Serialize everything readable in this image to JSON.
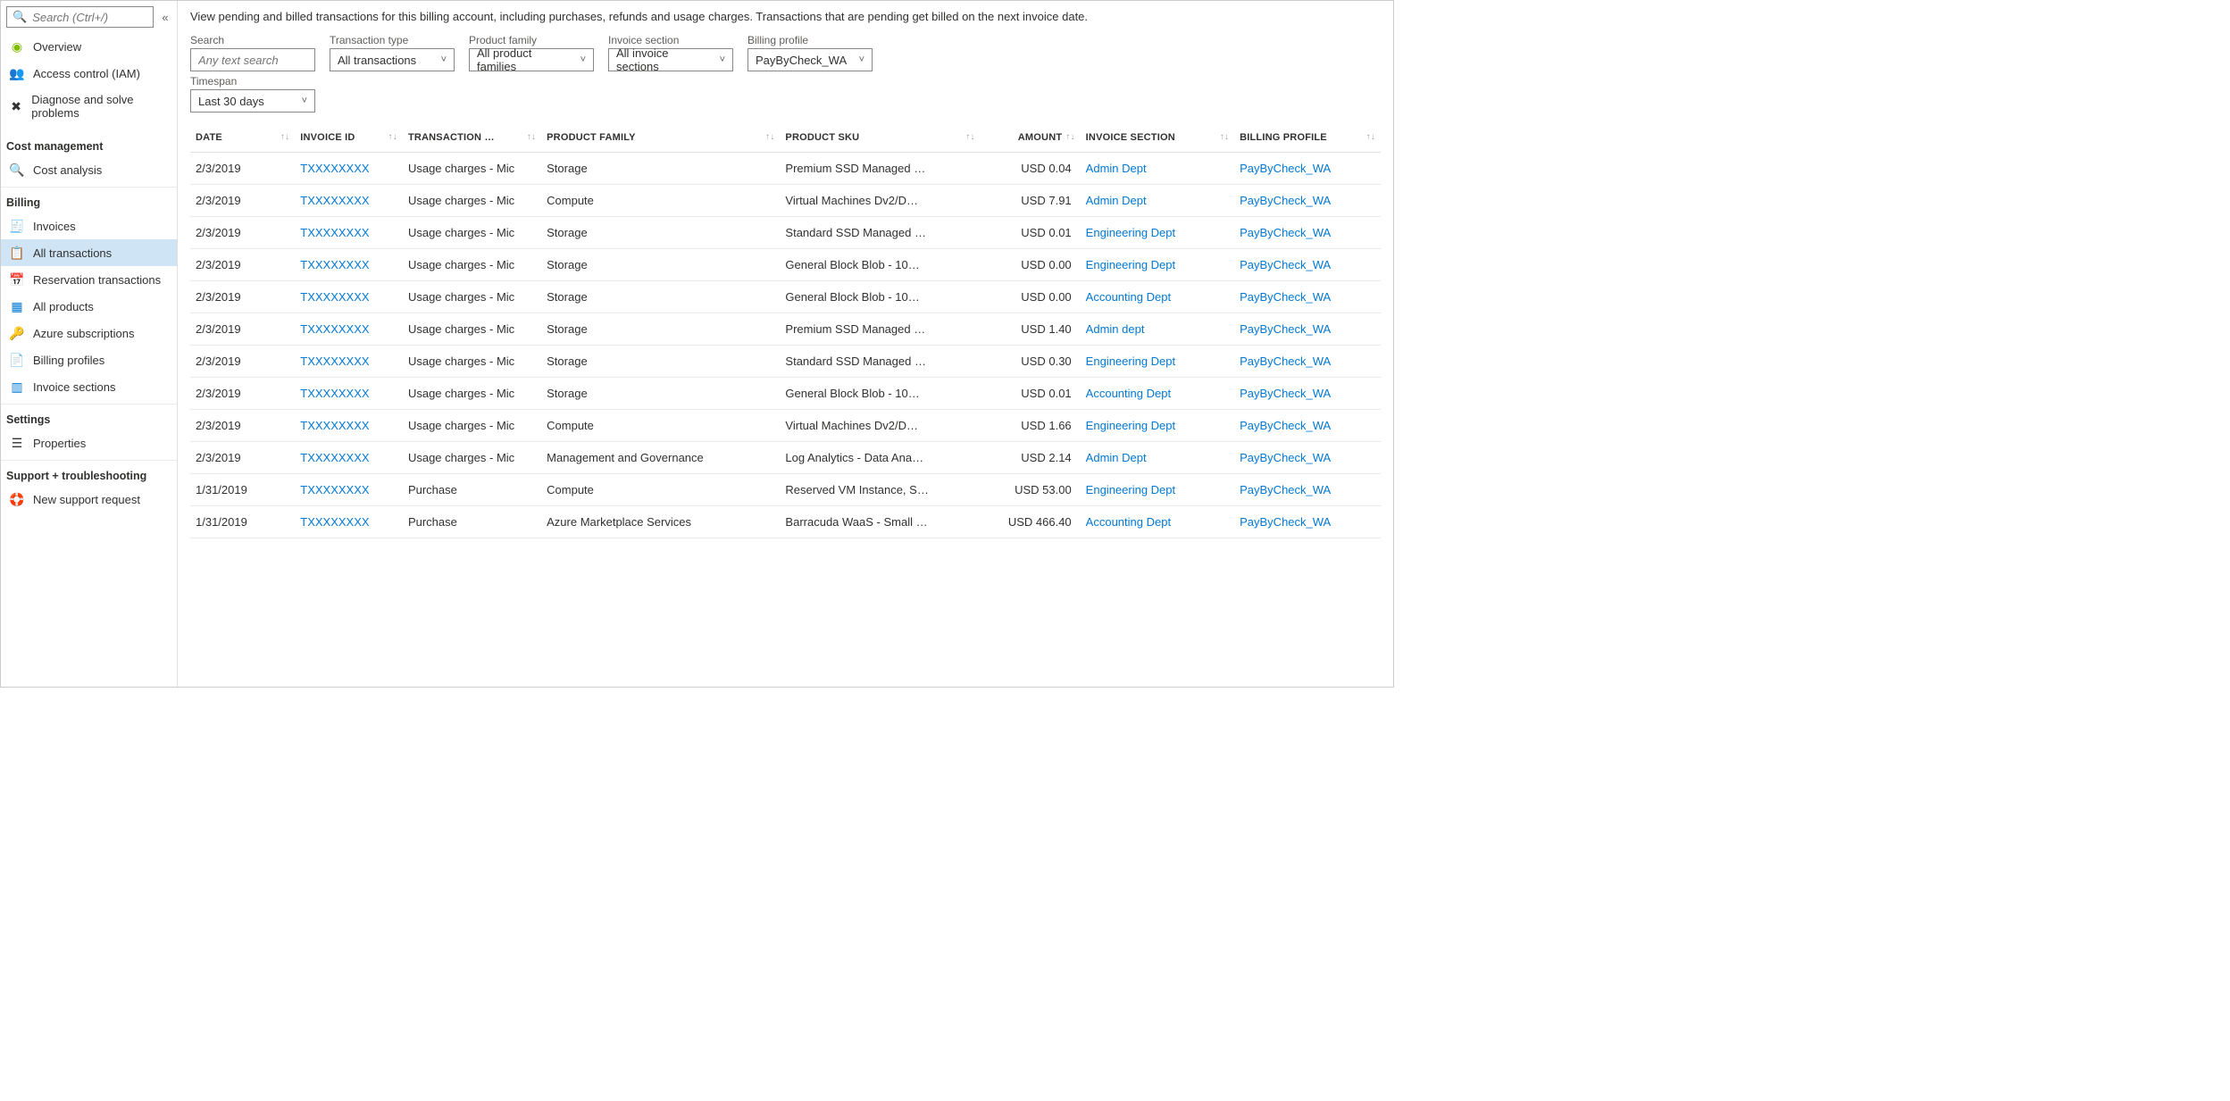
{
  "sidebar": {
    "search_placeholder": "Search (Ctrl+/)",
    "collapse": "«",
    "top_items": [
      {
        "icon": "overview",
        "label": "Overview"
      },
      {
        "icon": "iam",
        "label": "Access control (IAM)"
      },
      {
        "icon": "diagnose",
        "label": "Diagnose and solve problems"
      }
    ],
    "sections": [
      {
        "title": "Cost management",
        "items": [
          {
            "icon": "cost",
            "label": "Cost analysis"
          }
        ]
      },
      {
        "title": "Billing",
        "items": [
          {
            "icon": "invoices",
            "label": "Invoices"
          },
          {
            "icon": "alltx",
            "label": "All transactions",
            "active": true
          },
          {
            "icon": "resv",
            "label": "Reservation transactions"
          },
          {
            "icon": "products",
            "label": "All products"
          },
          {
            "icon": "azsub",
            "label": "Azure subscriptions"
          },
          {
            "icon": "bprof",
            "label": "Billing profiles"
          },
          {
            "icon": "invsec",
            "label": "Invoice sections"
          }
        ]
      },
      {
        "title": "Settings",
        "items": [
          {
            "icon": "props",
            "label": "Properties"
          }
        ]
      },
      {
        "title": "Support + troubleshooting",
        "items": [
          {
            "icon": "support",
            "label": "New support request"
          }
        ]
      }
    ]
  },
  "main": {
    "intro": "View pending and billed transactions for this billing account, including purchases, refunds and usage charges. Transactions that are pending get billed on the next invoice date.",
    "filters": {
      "search": {
        "label": "Search",
        "placeholder": "Any text search"
      },
      "transaction_type": {
        "label": "Transaction type",
        "value": "All transactions"
      },
      "product_family": {
        "label": "Product family",
        "value": "All product families"
      },
      "invoice_section": {
        "label": "Invoice section",
        "value": "All invoice sections"
      },
      "billing_profile": {
        "label": "Billing profile",
        "value": "PayByCheck_WA"
      },
      "timespan": {
        "label": "Timespan",
        "value": "Last 30 days"
      }
    },
    "columns": [
      "DATE",
      "INVOICE ID",
      "TRANSACTION …",
      "PRODUCT FAMILY",
      "PRODUCT SKU",
      "AMOUNT",
      "INVOICE SECTION",
      "BILLING PROFILE"
    ],
    "rows": [
      {
        "date": "2/3/2019",
        "invoice_id": "TXXXXXXXX",
        "transaction": "Usage charges - Mic",
        "product_family": "Storage",
        "product_sku": "Premium SSD Managed …",
        "amount": "USD 0.04",
        "invoice_section": "Admin Dept",
        "billing_profile": "PayByCheck_WA"
      },
      {
        "date": "2/3/2019",
        "invoice_id": "TXXXXXXXX",
        "transaction": "Usage charges - Mic",
        "product_family": "Compute",
        "product_sku": "Virtual Machines Dv2/D…",
        "amount": "USD 7.91",
        "invoice_section": "Admin Dept",
        "billing_profile": "PayByCheck_WA"
      },
      {
        "date": "2/3/2019",
        "invoice_id": "TXXXXXXXX",
        "transaction": "Usage charges - Mic",
        "product_family": "Storage",
        "product_sku": "Standard SSD Managed …",
        "amount": "USD 0.01",
        "invoice_section": "Engineering Dept",
        "billing_profile": "PayByCheck_WA"
      },
      {
        "date": "2/3/2019",
        "invoice_id": "TXXXXXXXX",
        "transaction": "Usage charges - Mic",
        "product_family": "Storage",
        "product_sku": "General Block Blob - 10…",
        "amount": "USD 0.00",
        "invoice_section": "Engineering Dept",
        "billing_profile": "PayByCheck_WA"
      },
      {
        "date": "2/3/2019",
        "invoice_id": "TXXXXXXXX",
        "transaction": "Usage charges - Mic",
        "product_family": "Storage",
        "product_sku": "General Block Blob - 10…",
        "amount": "USD 0.00",
        "invoice_section": "Accounting Dept",
        "billing_profile": "PayByCheck_WA"
      },
      {
        "date": "2/3/2019",
        "invoice_id": "TXXXXXXXX",
        "transaction": "Usage charges - Mic",
        "product_family": "Storage",
        "product_sku": "Premium SSD Managed …",
        "amount": "USD 1.40",
        "invoice_section": "Admin dept",
        "billing_profile": "PayByCheck_WA"
      },
      {
        "date": "2/3/2019",
        "invoice_id": "TXXXXXXXX",
        "transaction": "Usage charges - Mic",
        "product_family": "Storage",
        "product_sku": "Standard SSD Managed …",
        "amount": "USD 0.30",
        "invoice_section": "Engineering Dept",
        "billing_profile": "PayByCheck_WA"
      },
      {
        "date": "2/3/2019",
        "invoice_id": "TXXXXXXXX",
        "transaction": "Usage charges - Mic",
        "product_family": "Storage",
        "product_sku": "General Block Blob - 10…",
        "amount": "USD 0.01",
        "invoice_section": "Accounting Dept",
        "billing_profile": "PayByCheck_WA"
      },
      {
        "date": "2/3/2019",
        "invoice_id": "TXXXXXXXX",
        "transaction": "Usage charges - Mic",
        "product_family": "Compute",
        "product_sku": "Virtual Machines Dv2/D…",
        "amount": "USD 1.66",
        "invoice_section": "Engineering Dept",
        "billing_profile": "PayByCheck_WA"
      },
      {
        "date": "2/3/2019",
        "invoice_id": "TXXXXXXXX",
        "transaction": "Usage charges - Mic",
        "product_family": "Management and Governance",
        "product_sku": "Log Analytics - Data Ana…",
        "amount": "USD 2.14",
        "invoice_section": "Admin Dept",
        "billing_profile": "PayByCheck_WA"
      },
      {
        "date": "1/31/2019",
        "invoice_id": "TXXXXXXXX",
        "transaction": "Purchase",
        "product_family": "Compute",
        "product_sku": "Reserved VM Instance, S…",
        "amount": "USD 53.00",
        "invoice_section": "Engineering Dept",
        "billing_profile": "PayByCheck_WA"
      },
      {
        "date": "1/31/2019",
        "invoice_id": "TXXXXXXXX",
        "transaction": "Purchase",
        "product_family": "Azure Marketplace Services",
        "product_sku": "Barracuda WaaS - Small …",
        "amount": "USD 466.40",
        "invoice_section": "Accounting Dept",
        "billing_profile": "PayByCheck_WA"
      }
    ]
  },
  "icons": {
    "overview": {
      "glyph": "◉",
      "color": "#7fba00"
    },
    "iam": {
      "glyph": "👥",
      "color": "#0078d4"
    },
    "diagnose": {
      "glyph": "✖",
      "color": "#323130"
    },
    "cost": {
      "glyph": "🔍",
      "color": "#7fba00"
    },
    "invoices": {
      "glyph": "🧾",
      "color": "#605e5c"
    },
    "alltx": {
      "glyph": "📋",
      "color": "#605e5c"
    },
    "resv": {
      "glyph": "📅",
      "color": "#605e5c"
    },
    "products": {
      "glyph": "▦",
      "color": "#0078d4"
    },
    "azsub": {
      "glyph": "🔑",
      "color": "#ffb900"
    },
    "bprof": {
      "glyph": "📄",
      "color": "#605e5c"
    },
    "invsec": {
      "glyph": "▥",
      "color": "#0078d4"
    },
    "props": {
      "glyph": "☰",
      "color": "#323130"
    },
    "support": {
      "glyph": "🛟",
      "color": "#0078d4"
    }
  }
}
